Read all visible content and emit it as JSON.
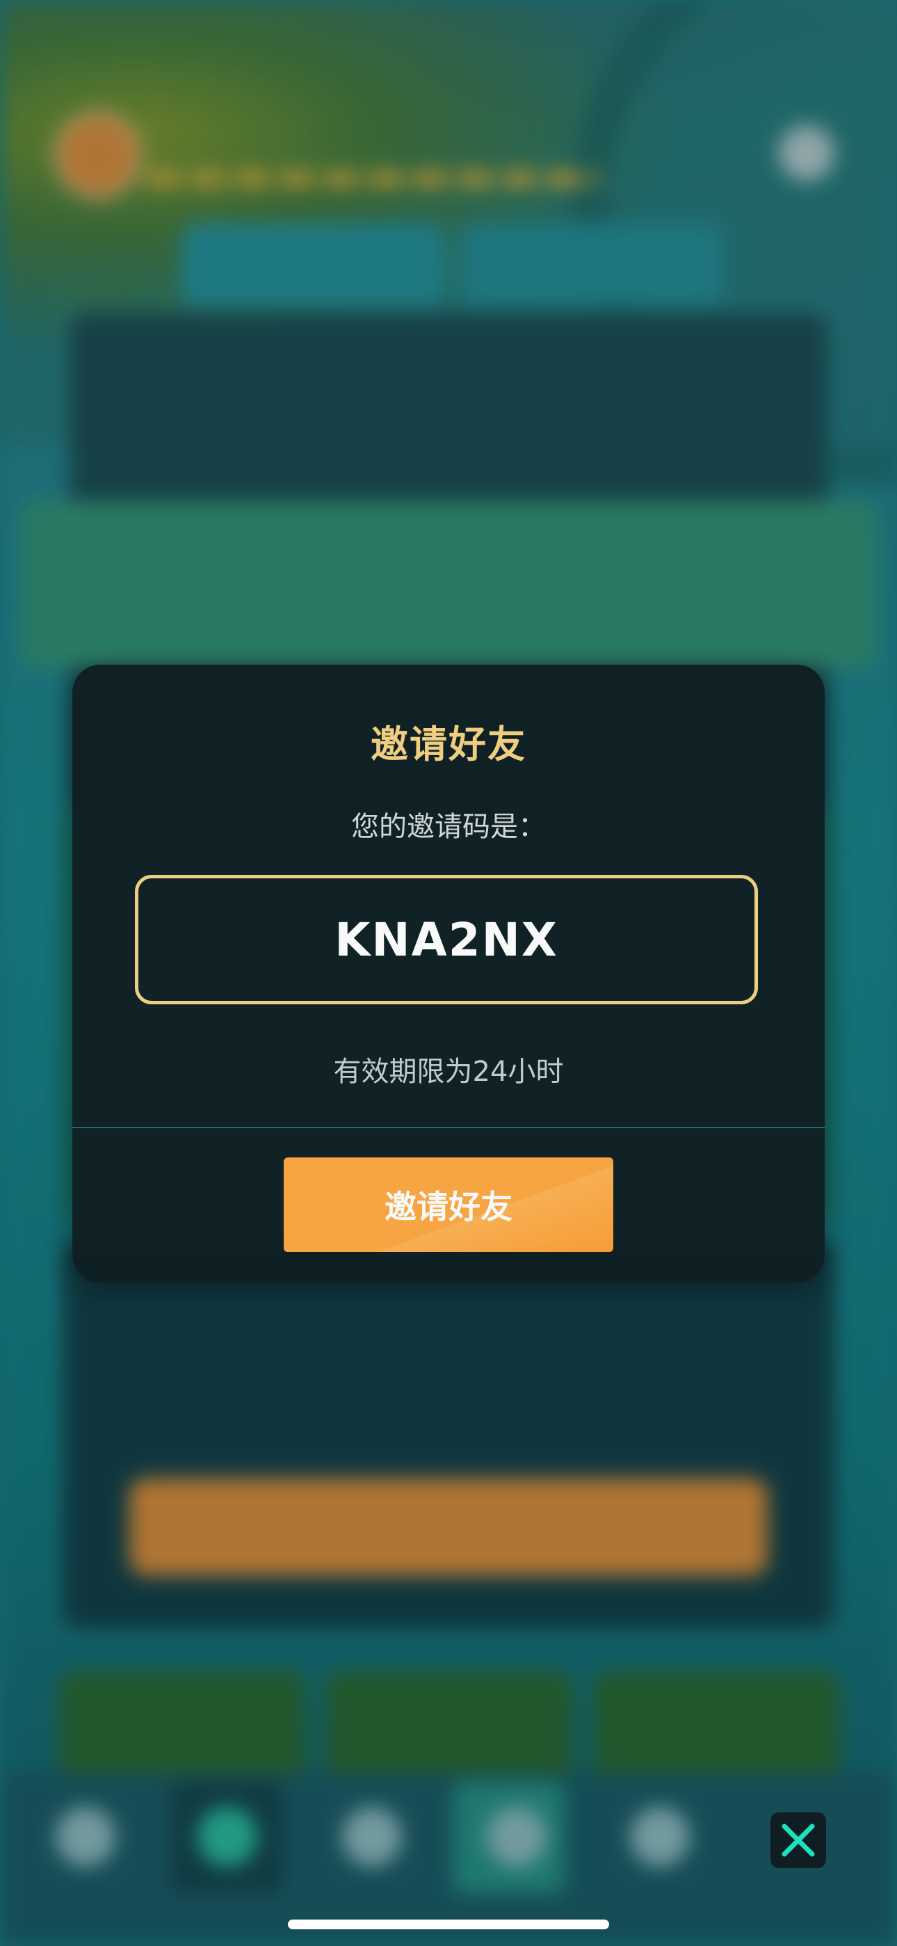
{
  "modal": {
    "title": "邀请好友",
    "subtitle": "您的邀请码是：",
    "invite_code": "KNA2NX",
    "validity_note": "有效期限为24小时",
    "invite_button_label": "邀请好友"
  },
  "icons": {
    "close": "close-icon"
  },
  "colors": {
    "modal_background": "#102024",
    "title": "#f7d283",
    "code_border": "#f2d385",
    "button": "#ffa843",
    "close_accent": "#1de0c0"
  }
}
